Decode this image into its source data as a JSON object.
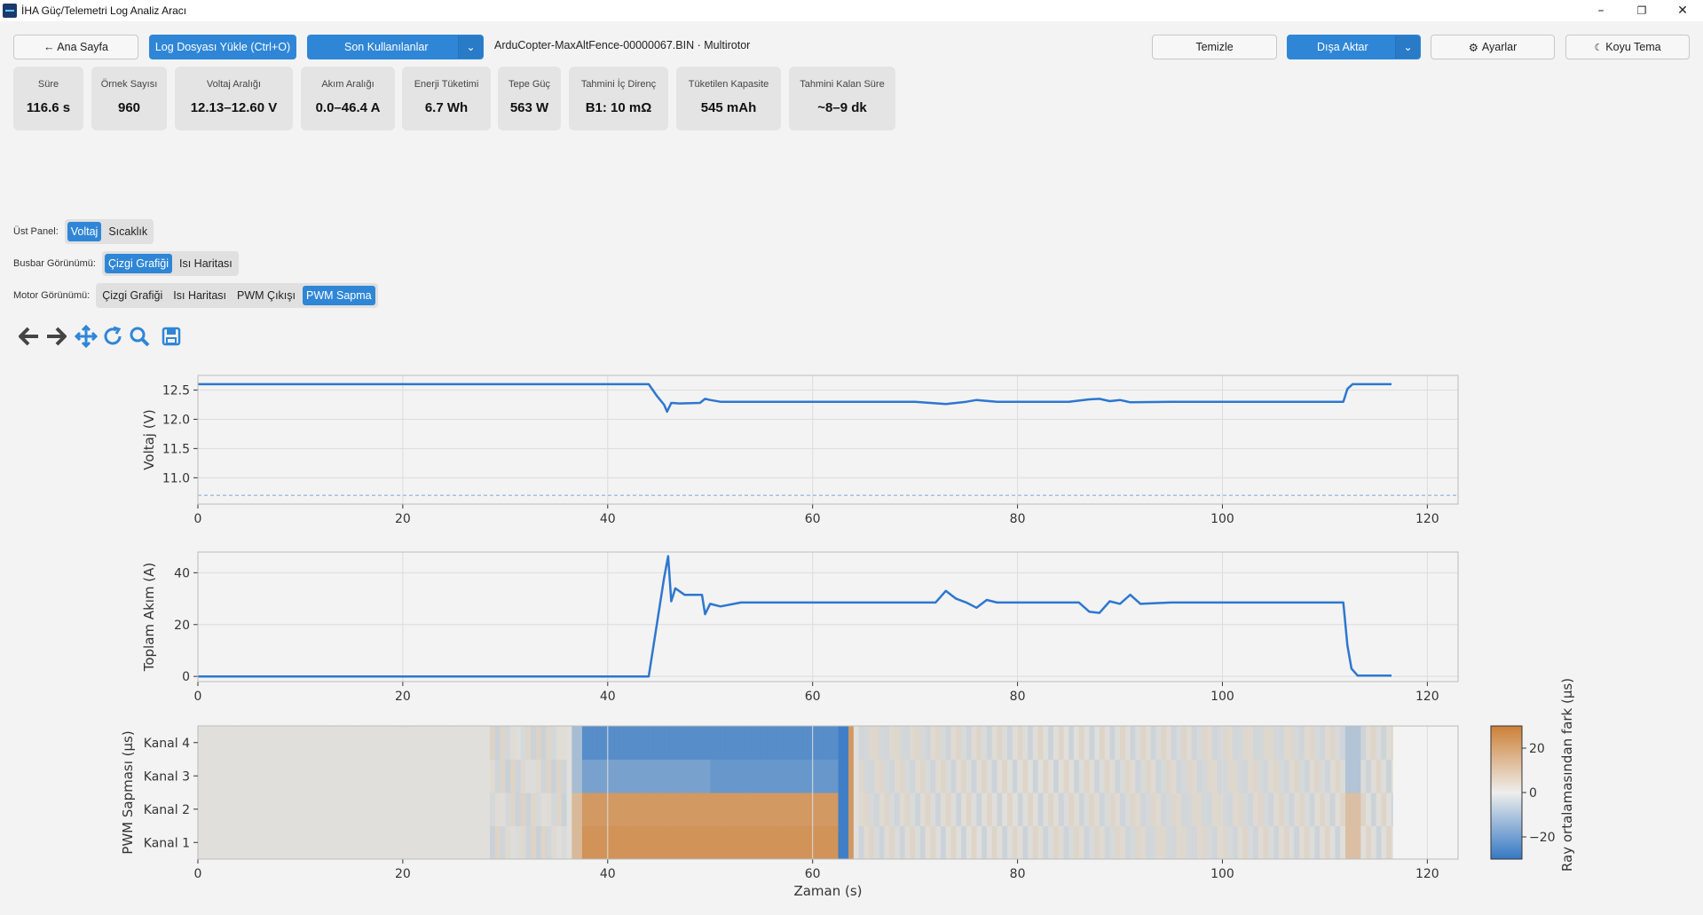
{
  "window": {
    "title": "İHA Güç/Telemetri Log Analiz Aracı"
  },
  "toolbar": {
    "home": "← Ana Sayfa",
    "load": "Log Dosyası Yükle (Ctrl+O)",
    "recent": "Son Kullanılanlar",
    "file": "ArduCopter-MaxAltFence-00000067.BIN · Multirotor",
    "clear": "Temizle",
    "export": "Dışa Aktar",
    "settings": "Ayarlar",
    "theme": "Koyu Tema"
  },
  "stats": [
    {
      "label": "Süre",
      "value": "116.6 s"
    },
    {
      "label": "Örnek Sayısı",
      "value": "960"
    },
    {
      "label": "Voltaj Aralığı",
      "value": "12.13–12.60 V"
    },
    {
      "label": "Akım Aralığı",
      "value": "0.0–46.4 A"
    },
    {
      "label": "Enerji Tüketimi",
      "value": "6.7 Wh"
    },
    {
      "label": "Tepe Güç",
      "value": "563 W"
    },
    {
      "label": "Tahmini İç Direnç",
      "value": "B1: 10 mΩ"
    },
    {
      "label": "Tüketilen Kapasite",
      "value": "545 mAh"
    },
    {
      "label": "Tahmini Kalan Süre",
      "value": "~8–9 dk"
    }
  ],
  "views": {
    "top": {
      "label": "Üst Panel:",
      "options": [
        "Voltaj",
        "Sıcaklık"
      ],
      "active": 0
    },
    "busbar": {
      "label": "Busbar Görünümü:",
      "options": [
        "Çizgi Grafiği",
        "Isı Haritası"
      ],
      "active": 0
    },
    "motor": {
      "label": "Motor Görünümü:",
      "options": [
        "Çizgi Grafiği",
        "Isı Haritası",
        "PWM Çıkışı",
        "PWM Sapma"
      ],
      "active": 3
    }
  },
  "colors": {
    "accent": "#2f86d6",
    "line": "#2d77cf"
  },
  "chart_data": [
    {
      "type": "line",
      "ylabel": "Voltaj (V)",
      "xlim": [
        0,
        123
      ],
      "ylim": [
        10.55,
        12.75
      ],
      "xticks": [
        0,
        20,
        40,
        60,
        80,
        100,
        120
      ],
      "yticks": [
        11.0,
        11.5,
        12.0,
        12.5
      ],
      "threshold": 10.7,
      "x": [
        0,
        44,
        44.8,
        45.5,
        45.8,
        46.2,
        47,
        49,
        49.5,
        50,
        51,
        60,
        70,
        73,
        75,
        76,
        78,
        80,
        85,
        87,
        88,
        89,
        90,
        91,
        95,
        100,
        105,
        111.8,
        112.2,
        112.7,
        113.5,
        116.5
      ],
      "y": [
        12.6,
        12.6,
        12.4,
        12.25,
        12.13,
        12.28,
        12.27,
        12.28,
        12.35,
        12.33,
        12.3,
        12.3,
        12.3,
        12.26,
        12.3,
        12.33,
        12.3,
        12.3,
        12.3,
        12.34,
        12.35,
        12.31,
        12.33,
        12.29,
        12.3,
        12.3,
        12.3,
        12.3,
        12.52,
        12.6,
        12.6,
        12.6
      ]
    },
    {
      "type": "line",
      "ylabel": "Toplam Akım (A)",
      "xlim": [
        0,
        123
      ],
      "ylim": [
        -2,
        48
      ],
      "xticks": [
        0,
        20,
        40,
        60,
        80,
        100,
        120
      ],
      "yticks": [
        0,
        20,
        40
      ],
      "x": [
        0,
        44,
        45.5,
        45.9,
        46.2,
        46.6,
        47.5,
        49.2,
        49.5,
        50,
        51,
        53,
        60,
        65,
        72,
        73,
        74,
        75,
        76,
        77,
        78,
        80,
        86,
        87,
        88,
        89,
        90,
        91,
        92,
        95,
        100,
        105,
        111.8,
        112.2,
        112.6,
        113.2,
        116.5
      ],
      "y": [
        0,
        0,
        38,
        46.4,
        29,
        34,
        31.5,
        31.5,
        24,
        28,
        27,
        28.5,
        28.5,
        28.5,
        28.5,
        33,
        30,
        28.5,
        26.5,
        29.5,
        28.5,
        28.5,
        28.5,
        25,
        24.5,
        29,
        28,
        31.5,
        28,
        28.5,
        28.5,
        28.5,
        28.5,
        12,
        3,
        0.3,
        0.3
      ]
    },
    {
      "type": "heatmap",
      "ylabel": "PWM Sapması (µs)",
      "xlabel": "Zaman (s)",
      "xlim": [
        0,
        123
      ],
      "xticks": [
        0,
        20,
        40,
        60,
        80,
        100,
        120
      ],
      "rows": [
        "Kanal 1",
        "Kanal 2",
        "Kanal 3",
        "Kanal 4"
      ],
      "colorbar_label": "Ray ortalamasından fark (µs)",
      "colorbar_range": [
        -30,
        30
      ],
      "colorbar_ticks": [
        -20,
        0,
        20
      ]
    }
  ]
}
